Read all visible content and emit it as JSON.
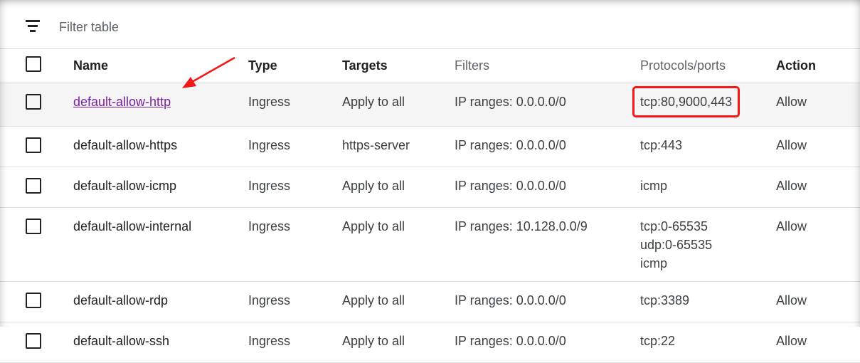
{
  "filter": {
    "icon": "filter-list-icon",
    "placeholder": "Filter table"
  },
  "columns": {
    "name": "Name",
    "type": "Type",
    "targets": "Targets",
    "filters": "Filters",
    "ports": "Protocols/ports",
    "action": "Action"
  },
  "rows": [
    {
      "name": "default-allow-http",
      "type": "Ingress",
      "targets": "Apply to all",
      "filters": "IP ranges: 0.0.0.0/0",
      "ports": [
        "tcp:80,9000,443"
      ],
      "action": "Allow"
    },
    {
      "name": "default-allow-https",
      "type": "Ingress",
      "targets": "https-server",
      "filters": "IP ranges: 0.0.0.0/0",
      "ports": [
        "tcp:443"
      ],
      "action": "Allow"
    },
    {
      "name": "default-allow-icmp",
      "type": "Ingress",
      "targets": "Apply to all",
      "filters": "IP ranges: 0.0.0.0/0",
      "ports": [
        "icmp"
      ],
      "action": "Allow"
    },
    {
      "name": "default-allow-internal",
      "type": "Ingress",
      "targets": "Apply to all",
      "filters": "IP ranges: 10.128.0.0/9",
      "ports": [
        "tcp:0-65535",
        "udp:0-65535",
        "icmp"
      ],
      "action": "Allow"
    },
    {
      "name": "default-allow-rdp",
      "type": "Ingress",
      "targets": "Apply to all",
      "filters": "IP ranges: 0.0.0.0/0",
      "ports": [
        "tcp:3389"
      ],
      "action": "Allow"
    },
    {
      "name": "default-allow-ssh",
      "type": "Ingress",
      "targets": "Apply to all",
      "filters": "IP ranges: 0.0.0.0/0",
      "ports": [
        "tcp:22"
      ],
      "action": "Allow"
    }
  ],
  "annotations": {
    "arrow_color": "#f21818",
    "highlight_box_color": "#f21818",
    "link_color": "#7b1fa2"
  }
}
